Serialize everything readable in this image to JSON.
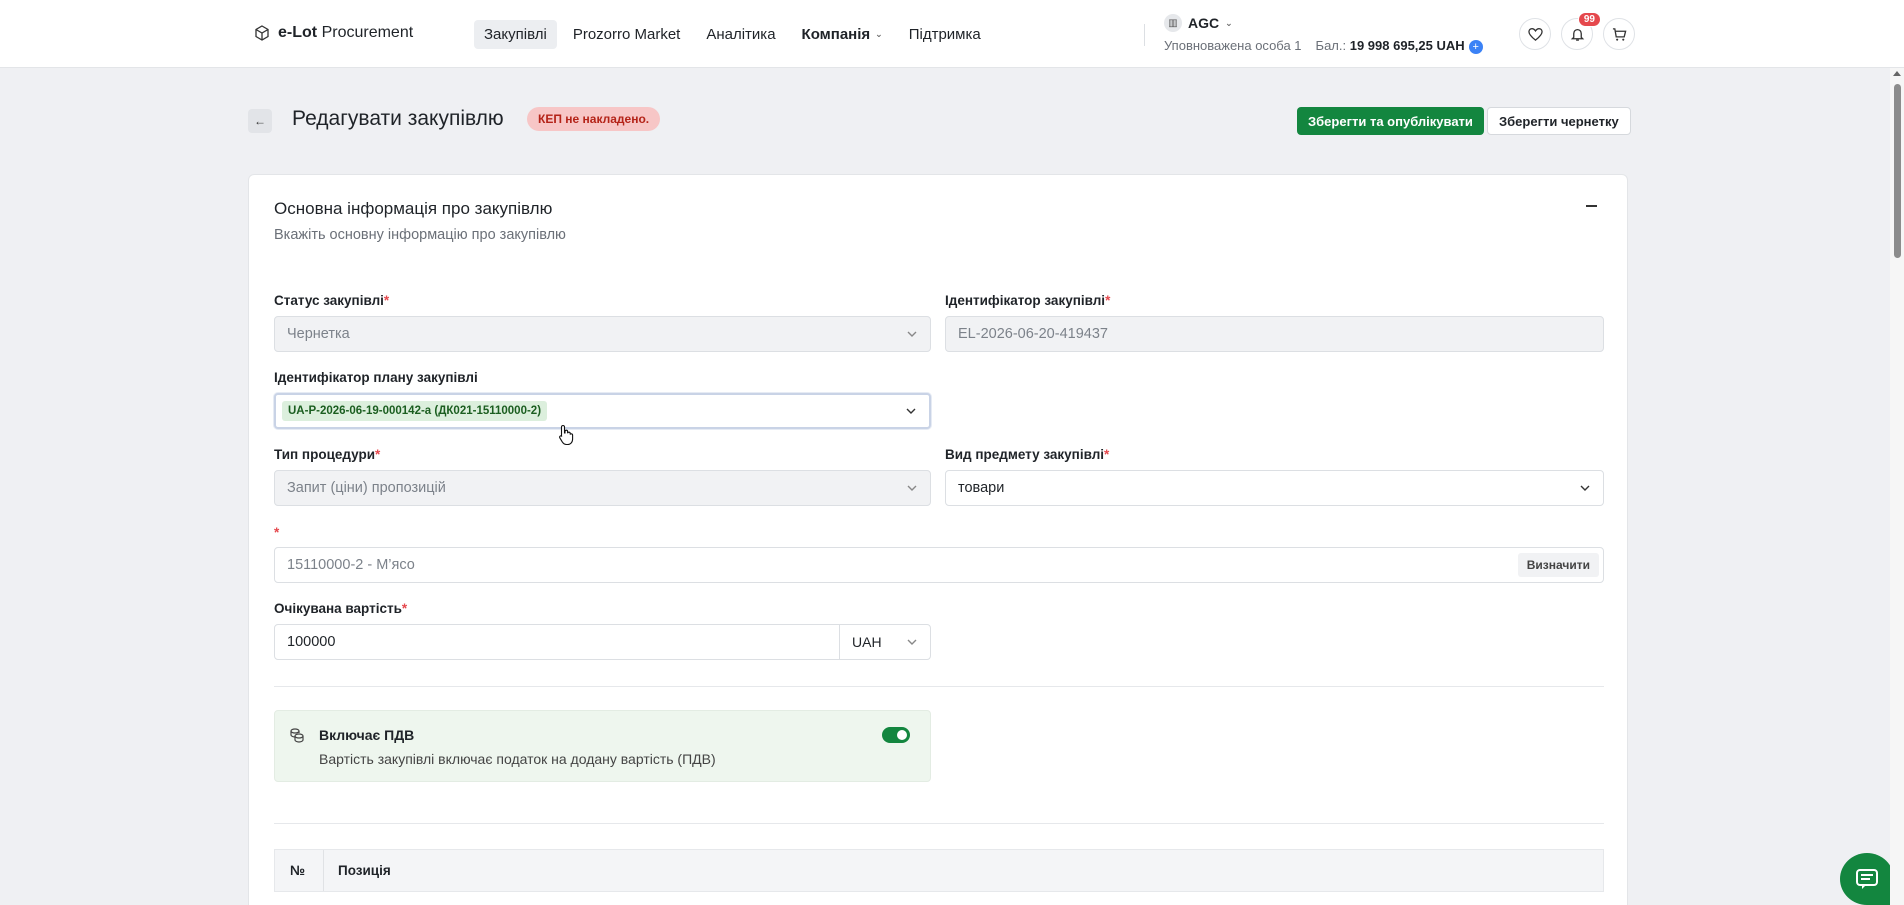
{
  "header": {
    "logo_text_bold": "e-Lot",
    "logo_text": "Procurement",
    "nav": [
      {
        "label": "Закупівлі",
        "active": true
      },
      {
        "label": "Prozorro Market"
      },
      {
        "label": "Аналітика"
      },
      {
        "label": "Компанія",
        "has_dropdown": true
      },
      {
        "label": "Підтримка"
      }
    ],
    "account": {
      "org": "AGC",
      "role": "Уповноважена особа 1",
      "balance_label": "Бал.:",
      "balance_value": "19 998 695,25 UAH"
    },
    "notifications_count": "99",
    "icons": [
      "heart-icon",
      "bell-icon",
      "cart-icon"
    ]
  },
  "page": {
    "title": "Редагувати закупівлю",
    "kep_badge": "КЕП не накладено.",
    "publish_button": "Зберегти та опублікувати",
    "draft_button": "Зберегти чернетку"
  },
  "card": {
    "title": "Основна інформація про закупівлю",
    "subtitle": "Вкажіть основну інформацію про закупівлю",
    "fields": {
      "status": {
        "label": "Статус закупівлі",
        "value": "Чернетка"
      },
      "identifier": {
        "label": "Ідентифікатор закупівлі",
        "value": "EL-2026-06-20-419437"
      },
      "plan_id": {
        "label": "Ідентифікатор плану закупівлі",
        "value": "UA-P-2026-06-19-000142-a (ДК021-15110000-2)"
      },
      "procedure": {
        "label": "Тип процедури",
        "value": "Запит (ціни) пропозицій"
      },
      "subject_type": {
        "label": "Вид предмету закупівлі",
        "value": "товари"
      },
      "classifier": {
        "value": "15110000-2 - М’ясо",
        "define_button": "Визначити"
      },
      "expected_value": {
        "label": "Очікувана вартість",
        "value": "100000",
        "currency": "UAH"
      }
    },
    "vat": {
      "title": "Включає ПДВ",
      "description": "Вартість закупівлі включає податок на додану вартість (ПДВ)",
      "enabled": true
    },
    "table": {
      "columns": [
        "№",
        "Позиція"
      ]
    }
  },
  "colors": {
    "primary": "#13863f",
    "danger_badge_bg": "#f7c6c6",
    "danger_text": "#b42318"
  }
}
